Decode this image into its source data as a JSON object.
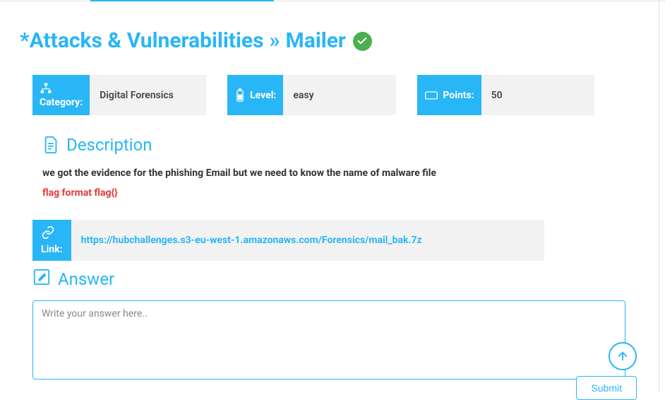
{
  "breadcrumb": {
    "root": "*Attacks & Vulnerabilities",
    "separator": "»",
    "current": "Mailer"
  },
  "meta": {
    "category": {
      "label": "Category:",
      "value": "Digital Forensics"
    },
    "level": {
      "label": "Level:",
      "value": "easy"
    },
    "points": {
      "label": "Points:",
      "value": "50"
    }
  },
  "description": {
    "heading": "Description",
    "body": "we got the evidence for the phishing Email but we need to know the name of malware file",
    "flag_format": "flag format flag{}"
  },
  "link": {
    "label": "Link:",
    "url": "https://hubchallenges.s3-eu-west-1.amazonaws.com/Forensics/mail_bak.7z"
  },
  "answer": {
    "heading": "Answer",
    "placeholder": "Write your answer here..",
    "submit_label": "Submit"
  },
  "colors": {
    "primary": "#29b6f6",
    "success": "#4caf50",
    "danger": "#e53935",
    "muted_bg": "#f2f2f2"
  }
}
